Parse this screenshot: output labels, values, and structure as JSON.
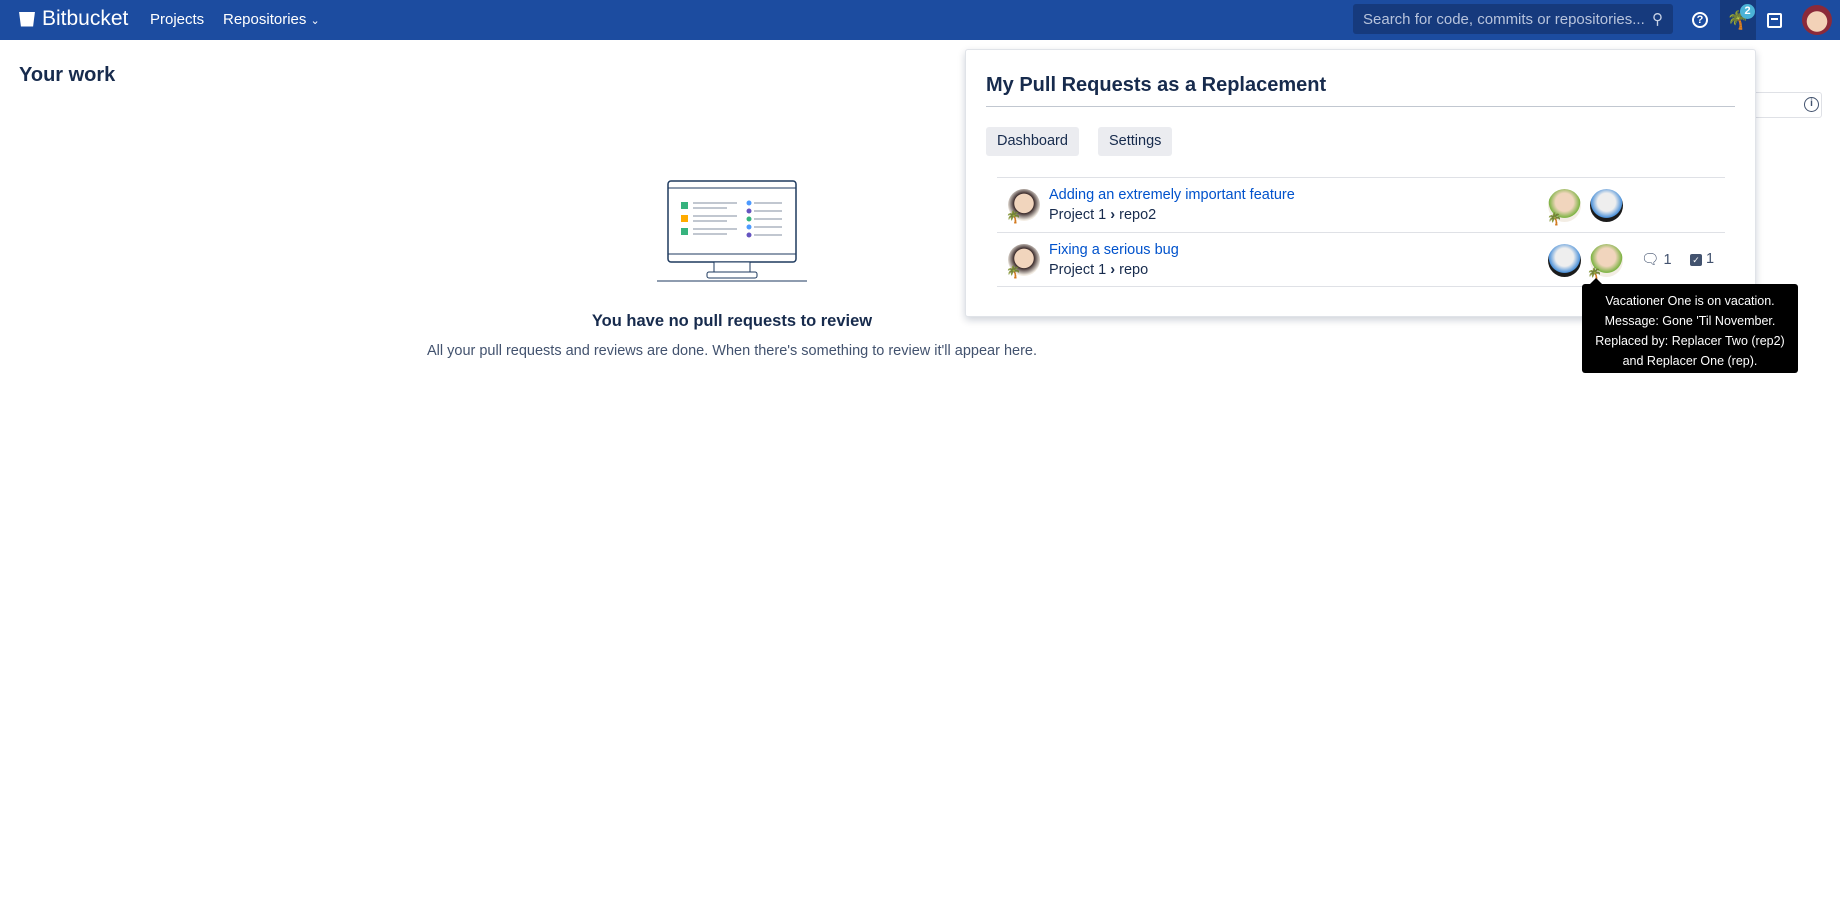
{
  "header": {
    "brand": "Bitbucket",
    "nav": [
      "Projects",
      "Repositories"
    ],
    "search_placeholder": "Search for code, commits or repositories...",
    "vacation_badge": "2"
  },
  "page": {
    "title": "Your work",
    "empty_title": "You have no pull requests to review",
    "empty_text": "All your pull requests and reviews are done. When there's something to review it'll appear here."
  },
  "popup": {
    "title": "My Pull Requests as a Replacement",
    "buttons": [
      "Dashboard",
      "Settings"
    ],
    "rows": [
      {
        "title": "Adding an extremely important feature",
        "project": "Project 1",
        "repo": "repo2",
        "comments": "",
        "tasks": ""
      },
      {
        "title": "Fixing a serious bug",
        "project": "Project 1",
        "repo": "repo",
        "comments": "1",
        "tasks": "1"
      }
    ]
  },
  "tooltip": {
    "lines": [
      "Vacationer One is on vacation.",
      "Message: Gone 'Til November.",
      "Replaced by: Replacer Two (rep2)",
      "and Replacer One (rep)."
    ]
  },
  "colors": {
    "header": "#1c4ca0",
    "link": "#0052cc",
    "badge": "#4bb3d6"
  }
}
